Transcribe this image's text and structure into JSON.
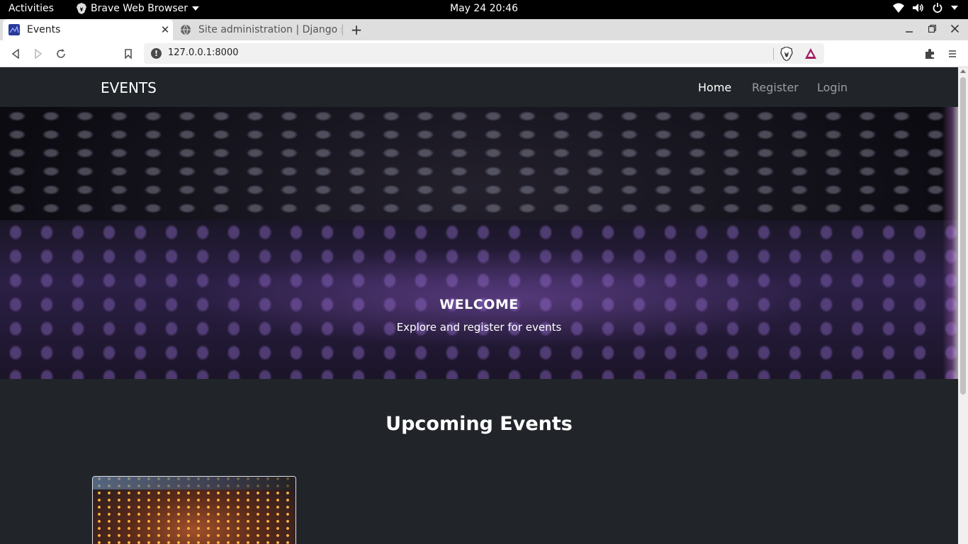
{
  "system": {
    "activities": "Activities",
    "app_name": "Brave Web Browser",
    "clock": "May 24  20:46",
    "tray_icons": [
      "wifi-icon",
      "volume-icon",
      "power-icon",
      "chevron-down-icon"
    ]
  },
  "tabs": [
    {
      "title": "Events",
      "active": true
    },
    {
      "title": "Site administration | Django s",
      "active": false
    }
  ],
  "toolbar": {
    "url": "127.0.0.1:8000"
  },
  "site": {
    "brand": "EVENTS",
    "nav": {
      "home": "Home",
      "register": "Register",
      "login": "Login"
    },
    "hero": {
      "heading": "WELCOME",
      "subtext": "Explore and register for events"
    },
    "section_title": "Upcoming Events"
  },
  "colors": {
    "page_bg": "#212529",
    "nav_active": "#ffffff",
    "nav_inactive": "#8c8f93",
    "brave_orange": "#fb542b"
  }
}
